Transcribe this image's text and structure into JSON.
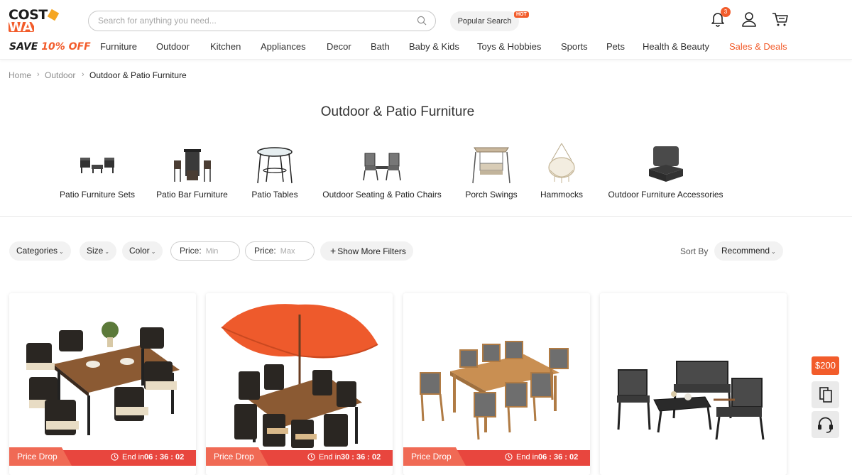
{
  "header": {
    "logo_line1": "COST",
    "logo_line2": "WAY",
    "promo_prefix": "SAVE ",
    "promo_highlight": "10% OFF",
    "search_placeholder": "Search for anything you need...",
    "popular_search": "Popular Search",
    "hot_badge": "HOT",
    "notification_count": "3",
    "icons": [
      "bell-icon",
      "user-icon",
      "cart-icon",
      "search-icon"
    ]
  },
  "nav": {
    "items": [
      "Furniture",
      "Outdoor",
      "Kitchen",
      "Appliances",
      "Decor",
      "Bath",
      "Baby & Kids",
      "Toys & Hobbies",
      "Sports",
      "Pets",
      "Health & Beauty",
      "Sales & Deals"
    ]
  },
  "breadcrumb": {
    "items": [
      "Home",
      "Outdoor",
      "Outdoor & Patio Furniture"
    ]
  },
  "page": {
    "title": "Outdoor & Patio Furniture"
  },
  "categories": [
    {
      "label": "Patio Furniture Sets"
    },
    {
      "label": "Patio Bar Furniture"
    },
    {
      "label": "Patio Tables"
    },
    {
      "label": "Outdoor Seating & Patio Chairs"
    },
    {
      "label": "Porch Swings"
    },
    {
      "label": "Hammocks"
    },
    {
      "label": "Outdoor Furniture Accessories"
    }
  ],
  "filters": {
    "categories": "Categories",
    "size": "Size",
    "color": "Color",
    "price_label": "Price:",
    "price_min_placeholder": "Min",
    "price_max_placeholder": "Max",
    "more_filters": "Show More Filters",
    "sort_label": "Sort By",
    "sort_value": "Recommend"
  },
  "products": [
    {
      "badge": "Price Drop",
      "end_label": "End in",
      "timer": "06 : 36 : 02"
    },
    {
      "badge": "Price Drop",
      "end_label": "End in",
      "timer": "30 : 36 : 02"
    },
    {
      "badge": "Price Drop",
      "end_label": "End in",
      "timer": "06 : 36 : 02"
    },
    {
      "badge": "",
      "end_label": "",
      "timer": ""
    }
  ],
  "side": {
    "coupon": "$200"
  },
  "colors": {
    "accent": "#f25c2b",
    "price_bar": "#e8463e"
  }
}
